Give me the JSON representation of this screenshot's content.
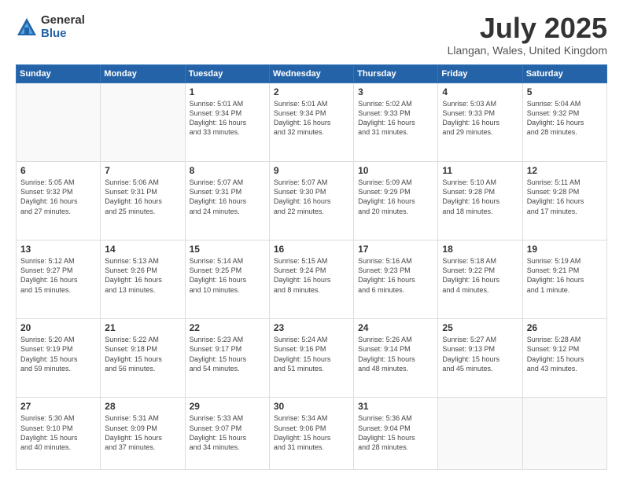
{
  "header": {
    "logo": {
      "general": "General",
      "blue": "Blue"
    },
    "title": "July 2025",
    "location": "Llangan, Wales, United Kingdom"
  },
  "weekdays": [
    "Sunday",
    "Monday",
    "Tuesday",
    "Wednesday",
    "Thursday",
    "Friday",
    "Saturday"
  ],
  "weeks": [
    [
      {
        "day": "",
        "info": ""
      },
      {
        "day": "",
        "info": ""
      },
      {
        "day": "1",
        "info": "Sunrise: 5:01 AM\nSunset: 9:34 PM\nDaylight: 16 hours\nand 33 minutes."
      },
      {
        "day": "2",
        "info": "Sunrise: 5:01 AM\nSunset: 9:34 PM\nDaylight: 16 hours\nand 32 minutes."
      },
      {
        "day": "3",
        "info": "Sunrise: 5:02 AM\nSunset: 9:33 PM\nDaylight: 16 hours\nand 31 minutes."
      },
      {
        "day": "4",
        "info": "Sunrise: 5:03 AM\nSunset: 9:33 PM\nDaylight: 16 hours\nand 29 minutes."
      },
      {
        "day": "5",
        "info": "Sunrise: 5:04 AM\nSunset: 9:32 PM\nDaylight: 16 hours\nand 28 minutes."
      }
    ],
    [
      {
        "day": "6",
        "info": "Sunrise: 5:05 AM\nSunset: 9:32 PM\nDaylight: 16 hours\nand 27 minutes."
      },
      {
        "day": "7",
        "info": "Sunrise: 5:06 AM\nSunset: 9:31 PM\nDaylight: 16 hours\nand 25 minutes."
      },
      {
        "day": "8",
        "info": "Sunrise: 5:07 AM\nSunset: 9:31 PM\nDaylight: 16 hours\nand 24 minutes."
      },
      {
        "day": "9",
        "info": "Sunrise: 5:07 AM\nSunset: 9:30 PM\nDaylight: 16 hours\nand 22 minutes."
      },
      {
        "day": "10",
        "info": "Sunrise: 5:09 AM\nSunset: 9:29 PM\nDaylight: 16 hours\nand 20 minutes."
      },
      {
        "day": "11",
        "info": "Sunrise: 5:10 AM\nSunset: 9:28 PM\nDaylight: 16 hours\nand 18 minutes."
      },
      {
        "day": "12",
        "info": "Sunrise: 5:11 AM\nSunset: 9:28 PM\nDaylight: 16 hours\nand 17 minutes."
      }
    ],
    [
      {
        "day": "13",
        "info": "Sunrise: 5:12 AM\nSunset: 9:27 PM\nDaylight: 16 hours\nand 15 minutes."
      },
      {
        "day": "14",
        "info": "Sunrise: 5:13 AM\nSunset: 9:26 PM\nDaylight: 16 hours\nand 13 minutes."
      },
      {
        "day": "15",
        "info": "Sunrise: 5:14 AM\nSunset: 9:25 PM\nDaylight: 16 hours\nand 10 minutes."
      },
      {
        "day": "16",
        "info": "Sunrise: 5:15 AM\nSunset: 9:24 PM\nDaylight: 16 hours\nand 8 minutes."
      },
      {
        "day": "17",
        "info": "Sunrise: 5:16 AM\nSunset: 9:23 PM\nDaylight: 16 hours\nand 6 minutes."
      },
      {
        "day": "18",
        "info": "Sunrise: 5:18 AM\nSunset: 9:22 PM\nDaylight: 16 hours\nand 4 minutes."
      },
      {
        "day": "19",
        "info": "Sunrise: 5:19 AM\nSunset: 9:21 PM\nDaylight: 16 hours\nand 1 minute."
      }
    ],
    [
      {
        "day": "20",
        "info": "Sunrise: 5:20 AM\nSunset: 9:19 PM\nDaylight: 15 hours\nand 59 minutes."
      },
      {
        "day": "21",
        "info": "Sunrise: 5:22 AM\nSunset: 9:18 PM\nDaylight: 15 hours\nand 56 minutes."
      },
      {
        "day": "22",
        "info": "Sunrise: 5:23 AM\nSunset: 9:17 PM\nDaylight: 15 hours\nand 54 minutes."
      },
      {
        "day": "23",
        "info": "Sunrise: 5:24 AM\nSunset: 9:16 PM\nDaylight: 15 hours\nand 51 minutes."
      },
      {
        "day": "24",
        "info": "Sunrise: 5:26 AM\nSunset: 9:14 PM\nDaylight: 15 hours\nand 48 minutes."
      },
      {
        "day": "25",
        "info": "Sunrise: 5:27 AM\nSunset: 9:13 PM\nDaylight: 15 hours\nand 45 minutes."
      },
      {
        "day": "26",
        "info": "Sunrise: 5:28 AM\nSunset: 9:12 PM\nDaylight: 15 hours\nand 43 minutes."
      }
    ],
    [
      {
        "day": "27",
        "info": "Sunrise: 5:30 AM\nSunset: 9:10 PM\nDaylight: 15 hours\nand 40 minutes."
      },
      {
        "day": "28",
        "info": "Sunrise: 5:31 AM\nSunset: 9:09 PM\nDaylight: 15 hours\nand 37 minutes."
      },
      {
        "day": "29",
        "info": "Sunrise: 5:33 AM\nSunset: 9:07 PM\nDaylight: 15 hours\nand 34 minutes."
      },
      {
        "day": "30",
        "info": "Sunrise: 5:34 AM\nSunset: 9:06 PM\nDaylight: 15 hours\nand 31 minutes."
      },
      {
        "day": "31",
        "info": "Sunrise: 5:36 AM\nSunset: 9:04 PM\nDaylight: 15 hours\nand 28 minutes."
      },
      {
        "day": "",
        "info": ""
      },
      {
        "day": "",
        "info": ""
      }
    ]
  ]
}
